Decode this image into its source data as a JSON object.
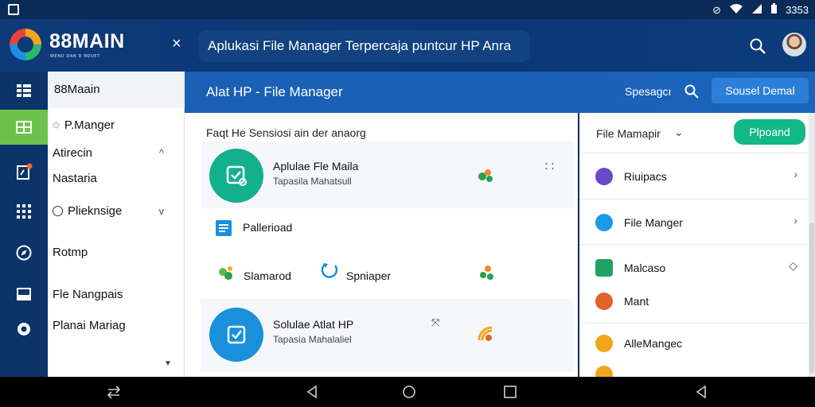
{
  "status_bar": {
    "time": "3353",
    "icons": [
      "screenshot-icon",
      "vpn-icon",
      "wifi-icon",
      "signal-icon",
      "battery-icon"
    ]
  },
  "header": {
    "brand": "88MAIN",
    "brand_sub": "ᴍᴇɴᴜ ᴅᴀɴ ᴅ ʙᴏᴜᴇᴛ",
    "close_label": "×",
    "search_text": "Aplukasi File Manager Terpercaja puntcur HP Anra"
  },
  "drawer": {
    "title": "88Maain",
    "items": [
      {
        "label": "P.Manger",
        "icon": "chat-icon"
      },
      {
        "label": "Atirecin",
        "chevron": "^"
      },
      {
        "label": "Nastaria"
      },
      {
        "label": "Plieknsige",
        "icon": "radio",
        "chevron": "v"
      },
      {
        "label": "Rotmp"
      },
      {
        "label": "Fle Nangpais"
      },
      {
        "label": "Planai Mariag"
      }
    ],
    "scroll_indicator": "▼"
  },
  "toolbar": {
    "title": "Alat HP - File Manager",
    "sort_label": "Spesagcı",
    "button_label": "Sousel Demal"
  },
  "main": {
    "section_title": "Faqt He Sensiosi ain der anaorg",
    "items": [
      {
        "title": "Aplulae Fle Maila",
        "subtitle": "Tapasila Mahatsull",
        "dots": "⠅⠅"
      },
      {
        "label": "Pallerioad"
      },
      {
        "label_a": "Slamarod",
        "label_b": "Spniaper"
      },
      {
        "title": "Solulae Atlat HP",
        "subtitle": "Tapasia Mahalaliel",
        "mark": "⤧"
      }
    ]
  },
  "right_panel": {
    "title": "File Mamapir",
    "chevron": "⌄",
    "button_label": "Plpoand",
    "rows": [
      {
        "label": "Riuipacs",
        "color": "#6a48c8",
        "arrow": "›"
      },
      {
        "label": "File Manger",
        "color": "#1a9be6",
        "arrow": "›"
      },
      {
        "label": "Malcaso",
        "color": "#1ea362",
        "arrow": "◇"
      },
      {
        "label": "Mant",
        "color": "#e2632a"
      },
      {
        "label": "AlleMangec",
        "color": "#f2a51b"
      }
    ]
  },
  "colors": {
    "header_bg": "#0e3a78",
    "toolbar_bg": "#1a5fb4",
    "rail_active": "#6cc24a",
    "teal": "#13b08e",
    "blue": "#1a8fdb",
    "green_button": "#12b886"
  }
}
